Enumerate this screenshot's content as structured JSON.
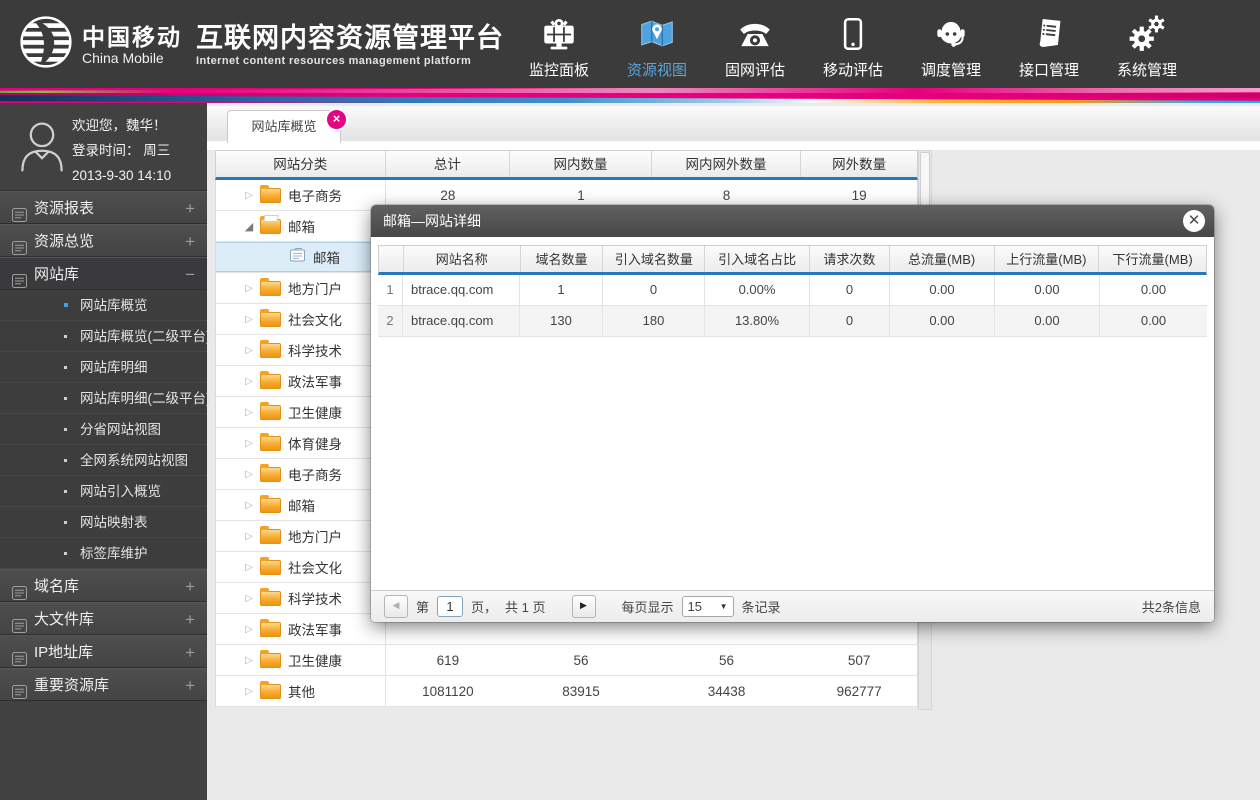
{
  "header": {
    "logo_cn": "中国移动",
    "logo_en": "China Mobile",
    "title": "互联网内容资源管理平台",
    "subtitle": "Internet content resources management platform",
    "nav": [
      {
        "name": "dashboard",
        "icon": "dashboard-icon",
        "label": "监控面板",
        "active": false
      },
      {
        "name": "resource-view",
        "icon": "map-icon",
        "label": "资源视图",
        "active": true
      },
      {
        "name": "fixed-network-eval",
        "icon": "phone-icon",
        "label": "固网评估",
        "active": false
      },
      {
        "name": "mobile-eval",
        "icon": "mobile-icon",
        "label": "移动评估",
        "active": false
      },
      {
        "name": "dispatch-mgmt",
        "icon": "headset-icon",
        "label": "调度管理",
        "active": false
      },
      {
        "name": "interface-mgmt",
        "icon": "document-icon",
        "label": "接口管理",
        "active": false
      },
      {
        "name": "system-mgmt",
        "icon": "gears-icon",
        "label": "系统管理",
        "active": false
      }
    ]
  },
  "sidebar": {
    "welcome": "欢迎您，魏华！",
    "login_line": "登录时间：  周三",
    "datetime_line": "2013-9-30   14:10",
    "menu": [
      {
        "name": "resource-report",
        "label": "资源报表",
        "expanded": false
      },
      {
        "name": "resource-overview",
        "label": "资源总览",
        "expanded": false
      },
      {
        "name": "website-lib",
        "label": "网站库",
        "expanded": true,
        "children": [
          {
            "label": "网站库概览",
            "active": true
          },
          {
            "label": "网站库概览(二级平台)",
            "active": false
          },
          {
            "label": "网站库明细",
            "active": false
          },
          {
            "label": "网站库明细(二级平台)",
            "active": false
          },
          {
            "label": "分省网站视图",
            "active": false
          },
          {
            "label": "全网系统网站视图",
            "active": false
          },
          {
            "label": "网站引入概览",
            "active": false
          },
          {
            "label": "网站映射表",
            "active": false
          },
          {
            "label": "标签库维护",
            "active": false
          }
        ]
      },
      {
        "name": "domain-lib",
        "label": "域名库",
        "expanded": false
      },
      {
        "name": "bigfile-lib",
        "label": "大文件库",
        "expanded": false
      },
      {
        "name": "ip-lib",
        "label": "IP地址库",
        "expanded": false
      },
      {
        "name": "key-resource-lib",
        "label": "重要资源库",
        "expanded": false
      }
    ]
  },
  "tab": {
    "label": "网站库概览"
  },
  "main_table": {
    "columns": [
      "网站分类",
      "总计",
      "网内数量",
      "网内网外数量",
      "网外数量"
    ],
    "rows": [
      {
        "label": "电子商务",
        "state": "collapsed",
        "values": [
          "28",
          "1",
          "8",
          "19"
        ]
      },
      {
        "label": "邮箱",
        "state": "expanded",
        "values": [
          "",
          "",
          "",
          ""
        ]
      },
      {
        "label": "邮箱",
        "state": "leaf",
        "selected": true,
        "values": [
          "",
          "",
          "",
          ""
        ]
      },
      {
        "label": "地方门户",
        "state": "collapsed",
        "values": [
          "",
          "",
          "",
          ""
        ]
      },
      {
        "label": "社会文化",
        "state": "collapsed",
        "values": [
          "",
          "",
          "",
          ""
        ]
      },
      {
        "label": "科学技术",
        "state": "collapsed",
        "values": [
          "",
          "",
          "",
          ""
        ]
      },
      {
        "label": "政法军事",
        "state": "collapsed",
        "values": [
          "",
          "",
          "",
          ""
        ]
      },
      {
        "label": "卫生健康",
        "state": "collapsed",
        "values": [
          "",
          "",
          "",
          ""
        ]
      },
      {
        "label": "体育健身",
        "state": "collapsed",
        "values": [
          "",
          "",
          "",
          ""
        ]
      },
      {
        "label": "电子商务",
        "state": "collapsed",
        "values": [
          "",
          "",
          "",
          ""
        ]
      },
      {
        "label": "邮箱",
        "state": "collapsed",
        "values": [
          "",
          "",
          "",
          ""
        ]
      },
      {
        "label": "地方门户",
        "state": "collapsed",
        "values": [
          "",
          "",
          "",
          ""
        ]
      },
      {
        "label": "社会文化",
        "state": "collapsed",
        "values": [
          "",
          "",
          "",
          ""
        ]
      },
      {
        "label": "科学技术",
        "state": "collapsed",
        "values": [
          "",
          "",
          "",
          ""
        ]
      },
      {
        "label": "政法军事",
        "state": "collapsed",
        "values": [
          "",
          "",
          "",
          ""
        ]
      },
      {
        "label": "卫生健康",
        "state": "collapsed",
        "values": [
          "619",
          "56",
          "56",
          "507"
        ]
      },
      {
        "label": "其他",
        "state": "collapsed",
        "values": [
          "1081120",
          "83915",
          "34438",
          "962777"
        ]
      }
    ]
  },
  "modal": {
    "title": "邮箱—网站详细",
    "columns": [
      "",
      "网站名称",
      "域名数量",
      "引入域名数量",
      "引入域名占比",
      "请求次数",
      "总流量(MB)",
      "上行流量(MB)",
      "下行流量(MB)"
    ],
    "rows": [
      [
        "1",
        "btrace.qq.com",
        "1",
        "0",
        "0.00%",
        "0",
        "0.00",
        "0.00",
        "0.00"
      ],
      [
        "2",
        "btrace.qq.com",
        "130",
        "180",
        "13.80%",
        "0",
        "0.00",
        "0.00",
        "0.00"
      ]
    ],
    "pagination": {
      "page_prefix": "第",
      "page_value": "1",
      "page_suffix": "页，",
      "total_pages": "共 1 页",
      "per_page_label": "每页显示",
      "per_page_value": "15",
      "per_page_suffix": "条记录",
      "total_info": "共2条信息"
    }
  },
  "colors": {
    "accent_blue": "#2779be",
    "nav_active": "#58a6dd",
    "badge_pink": "#e50382",
    "folder_orange": "#f6ab2f",
    "selected_row_bg": "#dcedf8",
    "header_bg": "#3b3b3b",
    "sidebar_bg": "#414141"
  }
}
